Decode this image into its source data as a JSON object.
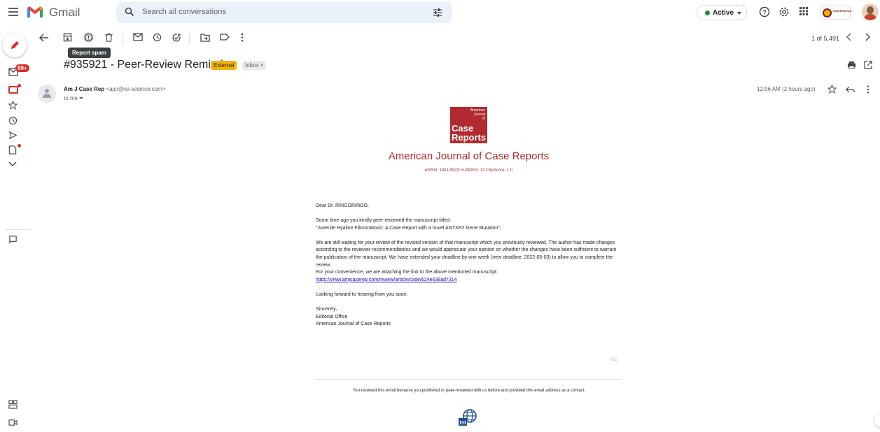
{
  "header": {
    "brand": "Gmail",
    "search_placeholder": "Search all conversations",
    "status_label": "Active",
    "org_label": "UNIVERSITAS"
  },
  "toolbar": {
    "tooltip": "Report spam",
    "counter": "1 of 5,491"
  },
  "rail": {
    "badge": "99+"
  },
  "message": {
    "subject": "#935921 - Peer-Review Reminder",
    "tag_external": "External",
    "tag_inbox": "Inbox ×",
    "sender_name": "Am J Case Rep",
    "sender_email": "<ajcr@isi-science.com>",
    "to": "to me",
    "time": "12:06 AM (2 hours ago)"
  },
  "journal": {
    "logo_line1": "American",
    "logo_line2": "Journal",
    "logo_line3": "of",
    "logo_line4": "Case",
    "logo_line5": "Reports",
    "title": "American Journal of Case Reports",
    "meta": "eISSN: 1941-5923   H-INDEX: 17   CiteScore: 1.0"
  },
  "body": {
    "greeting": "Dear Dr. RINGORINGO,",
    "p1_line1": "Some time ago you kindly peer-reviewed the manuscript titled:",
    "p1_line2": "\"Juvenile Hyaline Fibromatosis: A Case Report with a novel ANTXR2 Gene Mutation\".",
    "p2": "We are still waiting for your review of the revised version of that manuscript which you previously reviewed.  The author has made changes according to the reviewer recommendations and we would appreciate your opinion on whether the changes have been sufficient to warrant the publication of the manuscript.  We have extended your deadline by one week (new deadline: 2022-05-03) to allow you to complete the review.",
    "p2_line2": "For your convenience, we are attaching the link to the above mentioned manuscript:",
    "link": "https://www.amjcaserep.com/review/article/code/624e638ad7314",
    "p3": "Looking forward to hearing from you soon.",
    "sign1": "Sincerely,",
    "sign2": "Editorial Office",
    "sign3": "American Journal of Case Reports",
    "num": "911",
    "footer": "You received this email because you published or peer-reviewed with us before and provided this email address as a contact.",
    "isi": "ISI"
  }
}
